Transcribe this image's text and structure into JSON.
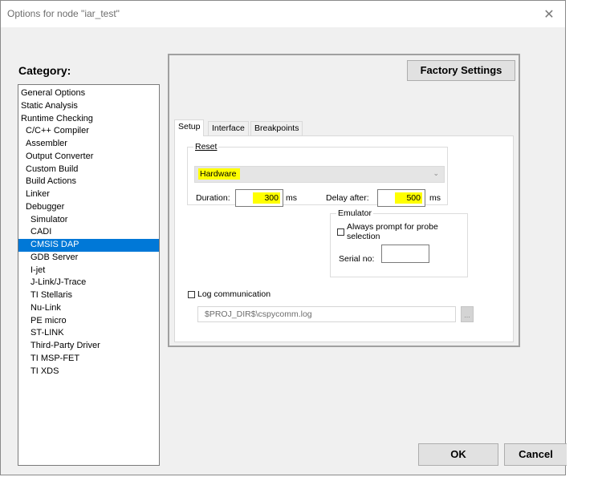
{
  "window": {
    "title": "Options for node \"iar_test\"",
    "close_glyph": "✕"
  },
  "category": {
    "label": "Category:",
    "items": [
      {
        "label": "General Options",
        "level": 0
      },
      {
        "label": "Static Analysis",
        "level": 0
      },
      {
        "label": "Runtime Checking",
        "level": 0
      },
      {
        "label": "C/C++ Compiler",
        "level": 1
      },
      {
        "label": "Assembler",
        "level": 1
      },
      {
        "label": "Output Converter",
        "level": 1
      },
      {
        "label": "Custom Build",
        "level": 1
      },
      {
        "label": "Build Actions",
        "level": 1
      },
      {
        "label": "Linker",
        "level": 1
      },
      {
        "label": "Debugger",
        "level": 1
      },
      {
        "label": "Simulator",
        "level": 2
      },
      {
        "label": "CADI",
        "level": 2
      },
      {
        "label": "CMSIS DAP",
        "level": 2,
        "selected": true
      },
      {
        "label": "GDB Server",
        "level": 2
      },
      {
        "label": "I-jet",
        "level": 2
      },
      {
        "label": "J-Link/J-Trace",
        "level": 2
      },
      {
        "label": "TI Stellaris",
        "level": 2
      },
      {
        "label": "Nu-Link",
        "level": 2
      },
      {
        "label": "PE micro",
        "level": 2
      },
      {
        "label": "ST-LINK",
        "level": 2
      },
      {
        "label": "Third-Party Driver",
        "level": 2
      },
      {
        "label": "TI MSP-FET",
        "level": 2
      },
      {
        "label": "TI XDS",
        "level": 2
      }
    ]
  },
  "panel": {
    "factory_settings": "Factory Settings",
    "tabs": [
      "Setup",
      "Interface",
      "Breakpoints"
    ],
    "reset": {
      "legend": "Reset",
      "mode": "Hardware",
      "duration_label": "Duration:",
      "duration_value": "300",
      "duration_unit": "ms",
      "delay_label": "Delay after:",
      "delay_value": "500",
      "delay_unit": "ms"
    },
    "emulator": {
      "legend": "Emulator",
      "prompt_label_1": "Always prompt for probe",
      "prompt_label_2": "selection",
      "prompt_checked": false,
      "serial_label": "Serial no:",
      "serial_value": ""
    },
    "log": {
      "label": "Log communication",
      "checked": false,
      "path": "$PROJ_DIR$\\cspycomm.log",
      "browse": "..."
    }
  },
  "buttons": {
    "ok": "OK",
    "cancel": "Cancel"
  },
  "colors": {
    "selection": "#0078d7",
    "highlight": "#ffff00"
  }
}
